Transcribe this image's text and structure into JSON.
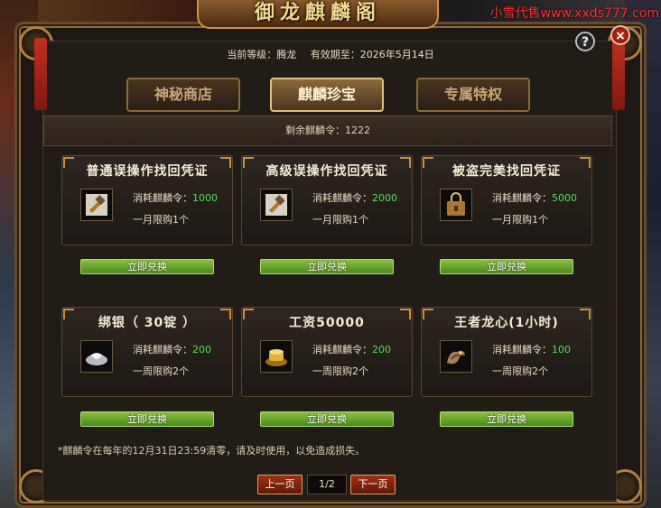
{
  "window": {
    "title": "御龙麒麟阁",
    "watermark": "小雪代售www.xxds777.com",
    "help_label": "?",
    "close_label": "×"
  },
  "status": {
    "level_text": "当前等级：腾龙",
    "expire_text": "有效期至：2026年5月14日"
  },
  "tabs": [
    {
      "label": "神秘商店",
      "active": false
    },
    {
      "label": "麒麟珍宝",
      "active": true
    },
    {
      "label": "专属特权",
      "active": false
    }
  ],
  "remaining_text": "剩余麒麟令：1222",
  "cost_label": "消耗麒麟令：",
  "buy_label": "立即兑换",
  "items": [
    {
      "title": "普通误操作找回凭证",
      "cost": "1000",
      "limit": "一月限购1个",
      "icon": "hammer-icon"
    },
    {
      "title": "高级误操作找回凭证",
      "cost": "2000",
      "limit": "一月限购1个",
      "icon": "hammer-icon"
    },
    {
      "title": "被盗完美找回凭证",
      "cost": "5000",
      "limit": "一月限购1个",
      "icon": "lock-bag-icon"
    },
    {
      "title": "绑银（ 30锭 ）",
      "cost": "200",
      "limit": "一周限购2个",
      "icon": "silver-ingot-icon"
    },
    {
      "title": "工资50000",
      "cost": "200",
      "limit": "一周限购2个",
      "icon": "gold-ingot-icon"
    },
    {
      "title": "王者龙心(1小时)",
      "cost": "100",
      "limit": "一周限购2个",
      "icon": "dragon-heart-icon"
    }
  ],
  "note": "*麒麟令在每年的12月31日23:59清零，请及时使用，以免造成损失。",
  "pager": {
    "prev_label": "上一页",
    "page_text": "1/2",
    "next_label": "下一页"
  },
  "colors": {
    "accent_gold": "#c89040",
    "cost_number": "#50e050",
    "button_green": "#6aa82e",
    "pager_red": "#a03010"
  }
}
